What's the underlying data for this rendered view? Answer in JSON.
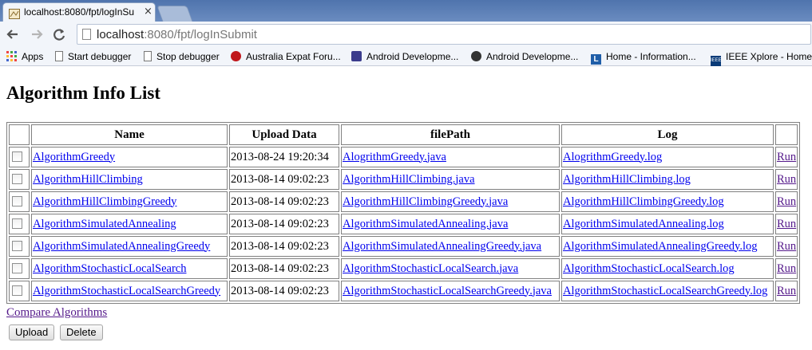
{
  "browser": {
    "tab_title": "localhost:8080/fpt/logInSu",
    "tab_close": "×",
    "url_host": "localhost",
    "url_rest": ":8080/fpt/logInSubmit",
    "bookmarks": [
      {
        "label": "Apps",
        "icon": "apps-grid-icon"
      },
      {
        "label": "Start debugger",
        "icon": "page-icon"
      },
      {
        "label": "Stop debugger",
        "icon": "page-icon"
      },
      {
        "label": "Australia Expat Foru...",
        "icon": "red-flower-icon"
      },
      {
        "label": "Android Developme...",
        "icon": "android-dev-icon"
      },
      {
        "label": "Android Developme...",
        "icon": "android-dark-icon"
      },
      {
        "label": "Home - Information...",
        "icon": "linkedin-l-icon"
      },
      {
        "label": "IEEE Xplore - Home",
        "icon": "ieee-icon"
      }
    ]
  },
  "page": {
    "heading": "Algorithm Info List",
    "table": {
      "headers": [
        "",
        "Name",
        "Upload Data",
        "filePath",
        "Log",
        ""
      ],
      "rows": [
        {
          "name": "AlgorithmGreedy",
          "upload": "2013-08-24 19:20:34",
          "file": "AlogrithmGreedy.java",
          "log": "AlogrithmGreedy.log",
          "action": "Run"
        },
        {
          "name": "AlgorithmHillClimbing",
          "upload": "2013-08-14 09:02:23",
          "file": "AlgorithmHillClimbing.java",
          "log": "AlgorithmHillClimbing.log",
          "action": "Run"
        },
        {
          "name": "AlgorithmHillClimbingGreedy",
          "upload": "2013-08-14 09:02:23",
          "file": "AlgorithmHillClimbingGreedy.java",
          "log": "AlgorithmHillClimbingGreedy.log",
          "action": "Run"
        },
        {
          "name": "AlgorithmSimulatedAnnealing",
          "upload": "2013-08-14 09:02:23",
          "file": "AlgorithmSimulatedAnnealing.java",
          "log": "AlgorithmSimulatedAnnealing.log",
          "action": "Run"
        },
        {
          "name": "AlgorithmSimulatedAnnealingGreedy",
          "upload": "2013-08-14 09:02:23",
          "file": "AlgorithmSimulatedAnnealingGreedy.java",
          "log": "AlgorithmSimulatedAnnealingGreedy.log",
          "action": "Run"
        },
        {
          "name": "AlgorithmStochasticLocalSearch",
          "upload": "2013-08-14 09:02:23",
          "file": "AlgorithmStochasticLocalSearch.java",
          "log": "AlgorithmStochasticLocalSearch.log",
          "action": "Run"
        },
        {
          "name": "AlgorithmStochasticLocalSearchGreedy",
          "upload": "2013-08-14 09:02:23",
          "file": "AlgorithmStochasticLocalSearchGreedy.java",
          "log": "AlgorithmStochasticLocalSearchGreedy.log",
          "action": "Run"
        }
      ]
    },
    "compare_link": "Compare Algorithms",
    "upload_button": "Upload",
    "delete_button": "Delete"
  },
  "colors": {
    "link": "#0000ee",
    "visited": "#551a8b",
    "tabstrip": "#5b7fb3"
  }
}
